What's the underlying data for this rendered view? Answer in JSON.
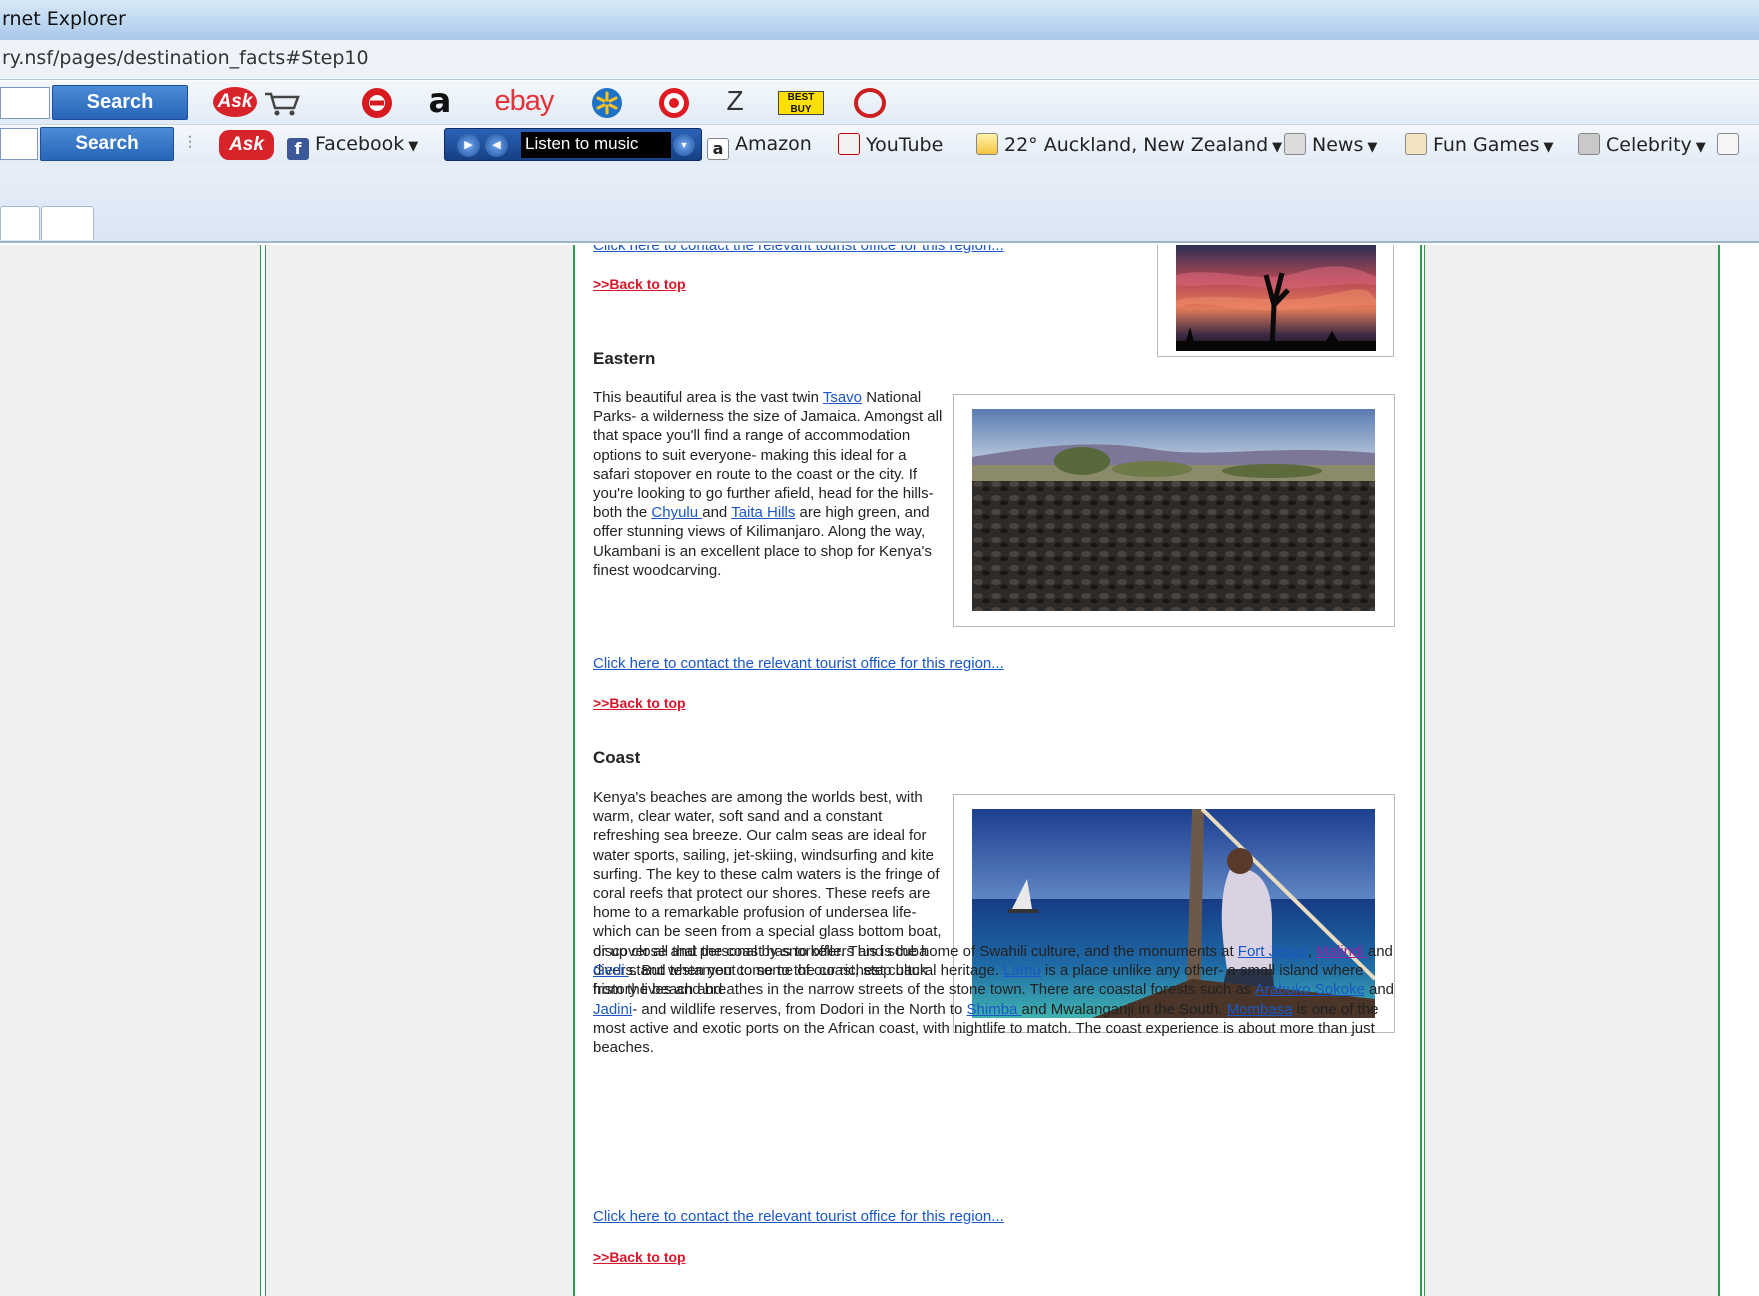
{
  "browser": {
    "window_title": "rnet Explorer",
    "address": "ry.nsf/pages/destination_facts#Step10"
  },
  "toolbar1": {
    "search_label": "Search",
    "ask_label": "Ask",
    "icons": [
      "cart-icon",
      "ask-cart-icon",
      "amazon-icon",
      "ebay-icon",
      "walmart-icon",
      "target-icon",
      "zappos-icon",
      "bestbuy-icon",
      "opera-icon"
    ],
    "amazon_glyph": "a",
    "ebay_label": "ebay",
    "zappos_label": "Z",
    "bestbuy_label": "BEST BUY"
  },
  "toolbar2": {
    "search_label": "Search",
    "ask_label": "Ask",
    "facebook": "Facebook",
    "listen": "Listen to music",
    "amazon": "Amazon",
    "youtube": "YouTube",
    "weather": "22° Auckland, New Zealand",
    "news": "News",
    "fun_games": "Fun Games",
    "celebrity": "Celebrity"
  },
  "content": {
    "top_contact_link": "Click here to contact the relevant tourist office for this region...",
    "back_to_top": ">>Back to top",
    "eastern": {
      "heading": "Eastern",
      "para_1": "This beautiful area is the vast twin ",
      "link_tsavo": "Tsavo",
      "para_2": " National Parks- a wilderness the size of Jamaica. Amongst all that space you'll find a range of accommodation options to suit everyone- making this ideal for a safari stopover en route to the coast or the city. If you're looking to go further afield, head for the hills- both the ",
      "link_chyulu": "Chyulu ",
      "para_3": "and ",
      "link_taita": "Taita Hills",
      "para_4": " are high green, and offer stunning views of Kilimanjaro. Along the way, Ukambani is an excellent place to shop for Kenya's finest woodcarving.",
      "contact_link": "Click here to contact the relevant tourist office for this region...",
      "back_to_top": ">>Back to top"
    },
    "coast": {
      "heading": "Coast",
      "para_1": "Kenya's beaches are among the worlds best, with warm, clear water, soft sand and a constant refreshing sea breeze. Our calm seas are ideal for water sports, sailing, jet-skiing, windsurfing and kite surfing. The key to these calm waters is the fringe of coral reefs that protect our shores. These reefs are home to a remarkable profusion of undersea life- which can be seen from a special glass bottom boat, or up close and personal by snorkellers and scuba divers. But when you come to the coast, step back from the beach and",
      "para_2_a": "discover all that the coast has to offer. This is the home of Swahili culture, and the monuments at ",
      "link_fort_jesus": "Fort Jesus",
      "para_2_b": ",  ",
      "link_malindi": "Malindi ",
      "para_2_c": "and ",
      "link_gedi": "Gedi ",
      "para_2_d": " stand testament to some of our richest cultural heritage. ",
      "link_lamu": "Lamu",
      "para_2_e": " is a place unlike any other- a small island where history lives and breathes in the narrow streets of the stone town. There are coastal forests such as ",
      "link_arabuko": "Arabuko Sokoke",
      "para_2_f": " and ",
      "link_jadini": "Jadini",
      "para_2_g": "- and wildlife reserves, from Dodori in the North to ",
      "link_shimba": "Shimba ",
      "para_2_h": " and Mwalanganji in the South. ",
      "link_mombasa": "Mombasa",
      "para_2_i": " is one of the most active and exotic ports on the African coast, with nightlife to match. The coast experience is about more than just beaches.",
      "contact_link": "Click here to contact the relevant tourist office for this region...",
      "back_to_top": ">>Back to top"
    }
  },
  "colors": {
    "link": "#1b56c4",
    "visited_link": "#9125a5",
    "back_to_top": "#d8162a",
    "border_green": "#2e9a4d"
  }
}
